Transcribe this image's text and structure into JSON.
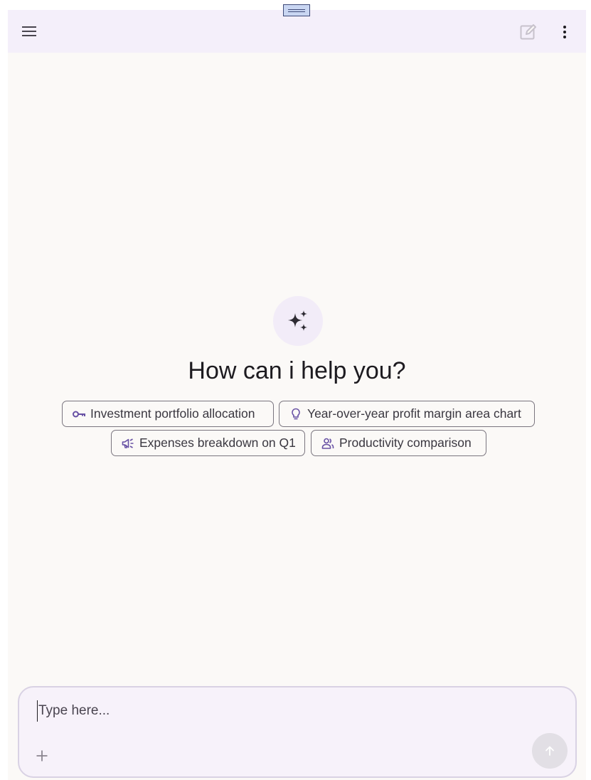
{
  "header": {
    "menu_icon": "menu-icon",
    "compose_icon": "edit-note-icon",
    "more_icon": "more-vert-icon"
  },
  "hero": {
    "icon": "sparkles-icon",
    "headline": "How can i help you?"
  },
  "suggestions": [
    {
      "label": "Investment portfolio allocation",
      "icon": "key-icon"
    },
    {
      "label": "Year-over-year profit margin area chart",
      "icon": "lightbulb-icon"
    },
    {
      "label": "Expenses breakdown on Q1",
      "icon": "campaign-icon"
    },
    {
      "label": "Productivity comparison",
      "icon": "people-icon"
    }
  ],
  "composer": {
    "placeholder": "Type here...",
    "value": "",
    "attach_icon": "plus-icon",
    "send_icon": "arrow-up-icon"
  },
  "colors": {
    "accent": "#6750a4",
    "header_bg": "#f4effa",
    "page_bg": "#fbf9f7"
  }
}
